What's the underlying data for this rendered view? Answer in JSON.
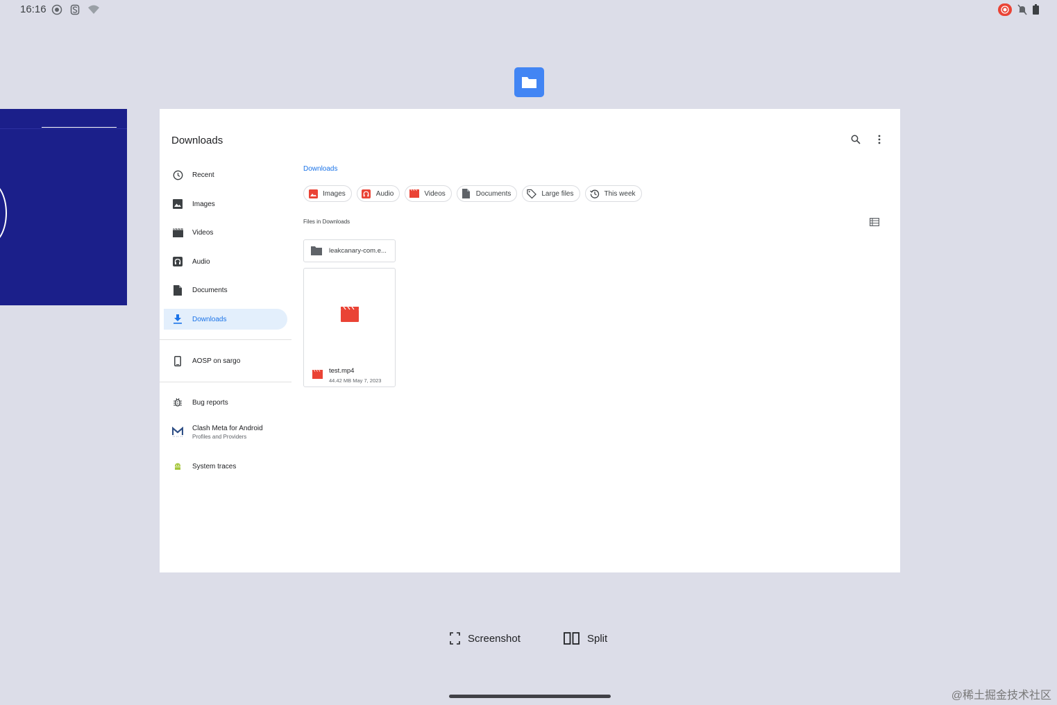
{
  "status_bar": {
    "time": "16:16",
    "left_icons": [
      "record-status-icon",
      "s-app-icon",
      "wifi-icon"
    ],
    "right_icons": [
      "screen-record-icon",
      "notifications-off-icon",
      "battery-icon"
    ]
  },
  "app": {
    "icon": "files-folder-icon",
    "accent": "#4285f4"
  },
  "window": {
    "title": "Downloads",
    "actions": [
      "search-icon",
      "more-vert-icon"
    ]
  },
  "drawer": {
    "items": [
      {
        "label": "Recent",
        "icon": "clock-icon"
      },
      {
        "label": "Images",
        "icon": "image-icon"
      },
      {
        "label": "Videos",
        "icon": "movie-icon"
      },
      {
        "label": "Audio",
        "icon": "headphones-icon"
      },
      {
        "label": "Documents",
        "icon": "document-icon"
      },
      {
        "label": "Downloads",
        "icon": "download-icon",
        "active": true
      }
    ],
    "devices": [
      {
        "label": "AOSP on sargo",
        "icon": "phone-icon"
      }
    ],
    "apps": [
      {
        "label": "Bug reports",
        "icon": "bug-icon"
      },
      {
        "label": "Clash Meta for Android",
        "sublabel": "Profiles and Providers",
        "icon": "clash-meta-icon"
      },
      {
        "label": "System traces",
        "icon": "android-icon"
      }
    ]
  },
  "content": {
    "breadcrumb": "Downloads",
    "chips": [
      {
        "label": "Images",
        "icon": "image-icon"
      },
      {
        "label": "Audio",
        "icon": "headphones-icon"
      },
      {
        "label": "Videos",
        "icon": "movie-icon"
      },
      {
        "label": "Documents",
        "icon": "document-icon"
      },
      {
        "label": "Large files",
        "icon": "tag-icon"
      },
      {
        "label": "This week",
        "icon": "history-icon"
      }
    ],
    "section_label": "Files in Downloads",
    "folder": {
      "name": "leakcanary-com.e..."
    },
    "file": {
      "name": "test.mp4",
      "size": "44.42 MB",
      "date": "May 7, 2023"
    }
  },
  "bottom_actions": {
    "screenshot_label": "Screenshot",
    "split_label": "Split"
  },
  "watermark": "@稀土掘金技术社区",
  "colors": {
    "background": "#dcdde8",
    "active_blue": "#1a73e8",
    "active_bg": "#e3effc",
    "media_red": "#ea4335",
    "recent_app_blue": "#1b1f8a"
  }
}
